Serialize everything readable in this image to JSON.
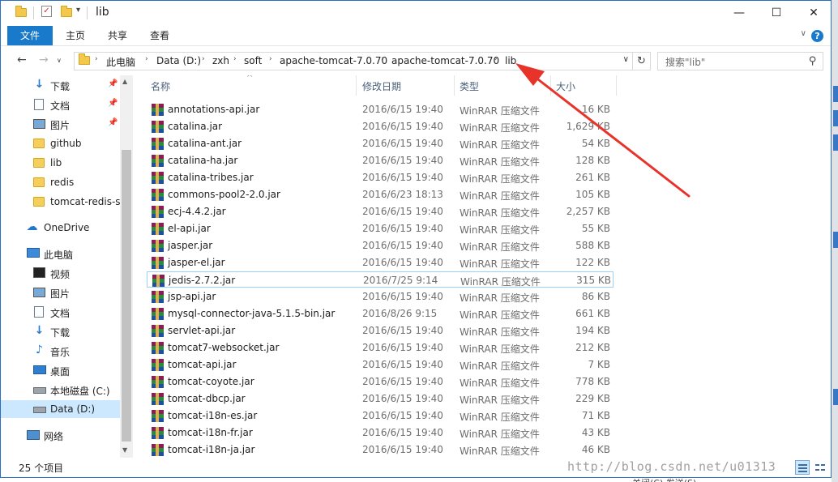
{
  "window": {
    "title": "lib",
    "controls": {
      "minimize": "—",
      "maximize": "☐",
      "close": "✕"
    }
  },
  "ribbon": {
    "tabs": [
      "文件",
      "主页",
      "共享",
      "查看"
    ],
    "help": "?",
    "expand": "∨"
  },
  "nav": {
    "back": "←",
    "forward": "→",
    "up_dropdown": "∨",
    "up": "↑",
    "breadcrumb": [
      "此电脑",
      "Data (D:)",
      "zxh",
      "soft",
      "apache-tomcat-7.0.70",
      "apache-tomcat-7.0.70",
      "lib"
    ],
    "search_placeholder": "搜索\"lib\"",
    "refresh": "↻"
  },
  "sidebar": {
    "items": [
      {
        "label": "下载",
        "icon": "download-icon",
        "pinned": true
      },
      {
        "label": "文档",
        "icon": "document-icon",
        "pinned": true
      },
      {
        "label": "图片",
        "icon": "picture-icon",
        "pinned": true
      },
      {
        "label": "github",
        "icon": "folder-icon"
      },
      {
        "label": "lib",
        "icon": "folder-icon"
      },
      {
        "label": "redis",
        "icon": "folder-icon"
      },
      {
        "label": "tomcat-redis-ses",
        "icon": "folder-icon"
      },
      {
        "label": "OneDrive",
        "icon": "onedrive-icon"
      },
      {
        "label": "此电脑",
        "icon": "this-pc-icon"
      },
      {
        "label": "视频",
        "icon": "video-icon"
      },
      {
        "label": "图片",
        "icon": "picture-icon"
      },
      {
        "label": "文档",
        "icon": "document-icon"
      },
      {
        "label": "下载",
        "icon": "download-icon"
      },
      {
        "label": "音乐",
        "icon": "music-icon"
      },
      {
        "label": "桌面",
        "icon": "desktop-icon"
      },
      {
        "label": "本地磁盘 (C:)",
        "icon": "drive-icon"
      },
      {
        "label": "Data (D:)",
        "icon": "drive-icon",
        "selected": true
      },
      {
        "label": "网络",
        "icon": "network-icon"
      }
    ]
  },
  "columns": [
    "名称",
    "修改日期",
    "类型",
    "大小"
  ],
  "files": [
    {
      "name": "annotations-api.jar",
      "date": "2016/6/15 19:40",
      "type": "WinRAR 压缩文件",
      "size": "16 KB"
    },
    {
      "name": "catalina.jar",
      "date": "2016/6/15 19:40",
      "type": "WinRAR 压缩文件",
      "size": "1,629 KB"
    },
    {
      "name": "catalina-ant.jar",
      "date": "2016/6/15 19:40",
      "type": "WinRAR 压缩文件",
      "size": "54 KB"
    },
    {
      "name": "catalina-ha.jar",
      "date": "2016/6/15 19:40",
      "type": "WinRAR 压缩文件",
      "size": "128 KB"
    },
    {
      "name": "catalina-tribes.jar",
      "date": "2016/6/15 19:40",
      "type": "WinRAR 压缩文件",
      "size": "261 KB"
    },
    {
      "name": "commons-pool2-2.0.jar",
      "date": "2016/6/23 18:13",
      "type": "WinRAR 压缩文件",
      "size": "105 KB"
    },
    {
      "name": "ecj-4.4.2.jar",
      "date": "2016/6/15 19:40",
      "type": "WinRAR 压缩文件",
      "size": "2,257 KB"
    },
    {
      "name": "el-api.jar",
      "date": "2016/6/15 19:40",
      "type": "WinRAR 压缩文件",
      "size": "55 KB"
    },
    {
      "name": "jasper.jar",
      "date": "2016/6/15 19:40",
      "type": "WinRAR 压缩文件",
      "size": "588 KB"
    },
    {
      "name": "jasper-el.jar",
      "date": "2016/6/15 19:40",
      "type": "WinRAR 压缩文件",
      "size": "122 KB"
    },
    {
      "name": "jedis-2.7.2.jar",
      "date": "2016/7/25 9:14",
      "type": "WinRAR 压缩文件",
      "size": "315 KB",
      "selected": true
    },
    {
      "name": "jsp-api.jar",
      "date": "2016/6/15 19:40",
      "type": "WinRAR 压缩文件",
      "size": "86 KB"
    },
    {
      "name": "mysql-connector-java-5.1.5-bin.jar",
      "date": "2016/8/26 9:15",
      "type": "WinRAR 压缩文件",
      "size": "661 KB"
    },
    {
      "name": "servlet-api.jar",
      "date": "2016/6/15 19:40",
      "type": "WinRAR 压缩文件",
      "size": "194 KB"
    },
    {
      "name": "tomcat7-websocket.jar",
      "date": "2016/6/15 19:40",
      "type": "WinRAR 压缩文件",
      "size": "212 KB"
    },
    {
      "name": "tomcat-api.jar",
      "date": "2016/6/15 19:40",
      "type": "WinRAR 压缩文件",
      "size": "7 KB"
    },
    {
      "name": "tomcat-coyote.jar",
      "date": "2016/6/15 19:40",
      "type": "WinRAR 压缩文件",
      "size": "778 KB"
    },
    {
      "name": "tomcat-dbcp.jar",
      "date": "2016/6/15 19:40",
      "type": "WinRAR 压缩文件",
      "size": "229 KB"
    },
    {
      "name": "tomcat-i18n-es.jar",
      "date": "2016/6/15 19:40",
      "type": "WinRAR 压缩文件",
      "size": "71 KB"
    },
    {
      "name": "tomcat-i18n-fr.jar",
      "date": "2016/6/15 19:40",
      "type": "WinRAR 压缩文件",
      "size": "43 KB"
    },
    {
      "name": "tomcat-i18n-ja.jar",
      "date": "2016/6/15 19:40",
      "type": "WinRAR 压缩文件",
      "size": "46 KB"
    }
  ],
  "status": {
    "item_count": "25 个项目"
  },
  "watermark": "http://blog.csdn.net/u01313",
  "bottom_peek": "关闭(C)    发送(S)",
  "colors": {
    "accent": "#1979ca",
    "selection": "#cce8ff",
    "annotation_arrow": "#e8332a"
  }
}
